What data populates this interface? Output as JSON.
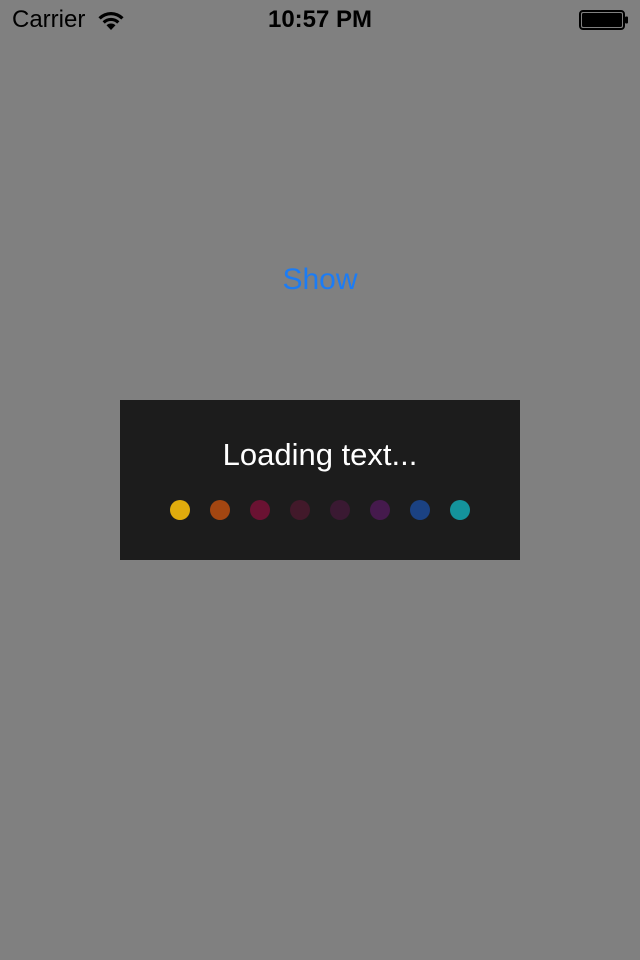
{
  "status_bar": {
    "carrier": "Carrier",
    "wifi_icon": "wifi-icon",
    "time": "10:57 PM",
    "battery_icon": "battery-icon"
  },
  "main": {
    "show_label": "Show",
    "accent_color": "#1c7cf4"
  },
  "hud": {
    "text": "Loading text...",
    "background": "#1c1c1c",
    "dots": [
      {
        "color": "#e0ac0d"
      },
      {
        "color": "#a34611"
      },
      {
        "color": "#6a1232"
      },
      {
        "color": "#42192a"
      },
      {
        "color": "#3a1932"
      },
      {
        "color": "#451a4d"
      },
      {
        "color": "#1b4283"
      },
      {
        "color": "#14939c"
      }
    ]
  }
}
